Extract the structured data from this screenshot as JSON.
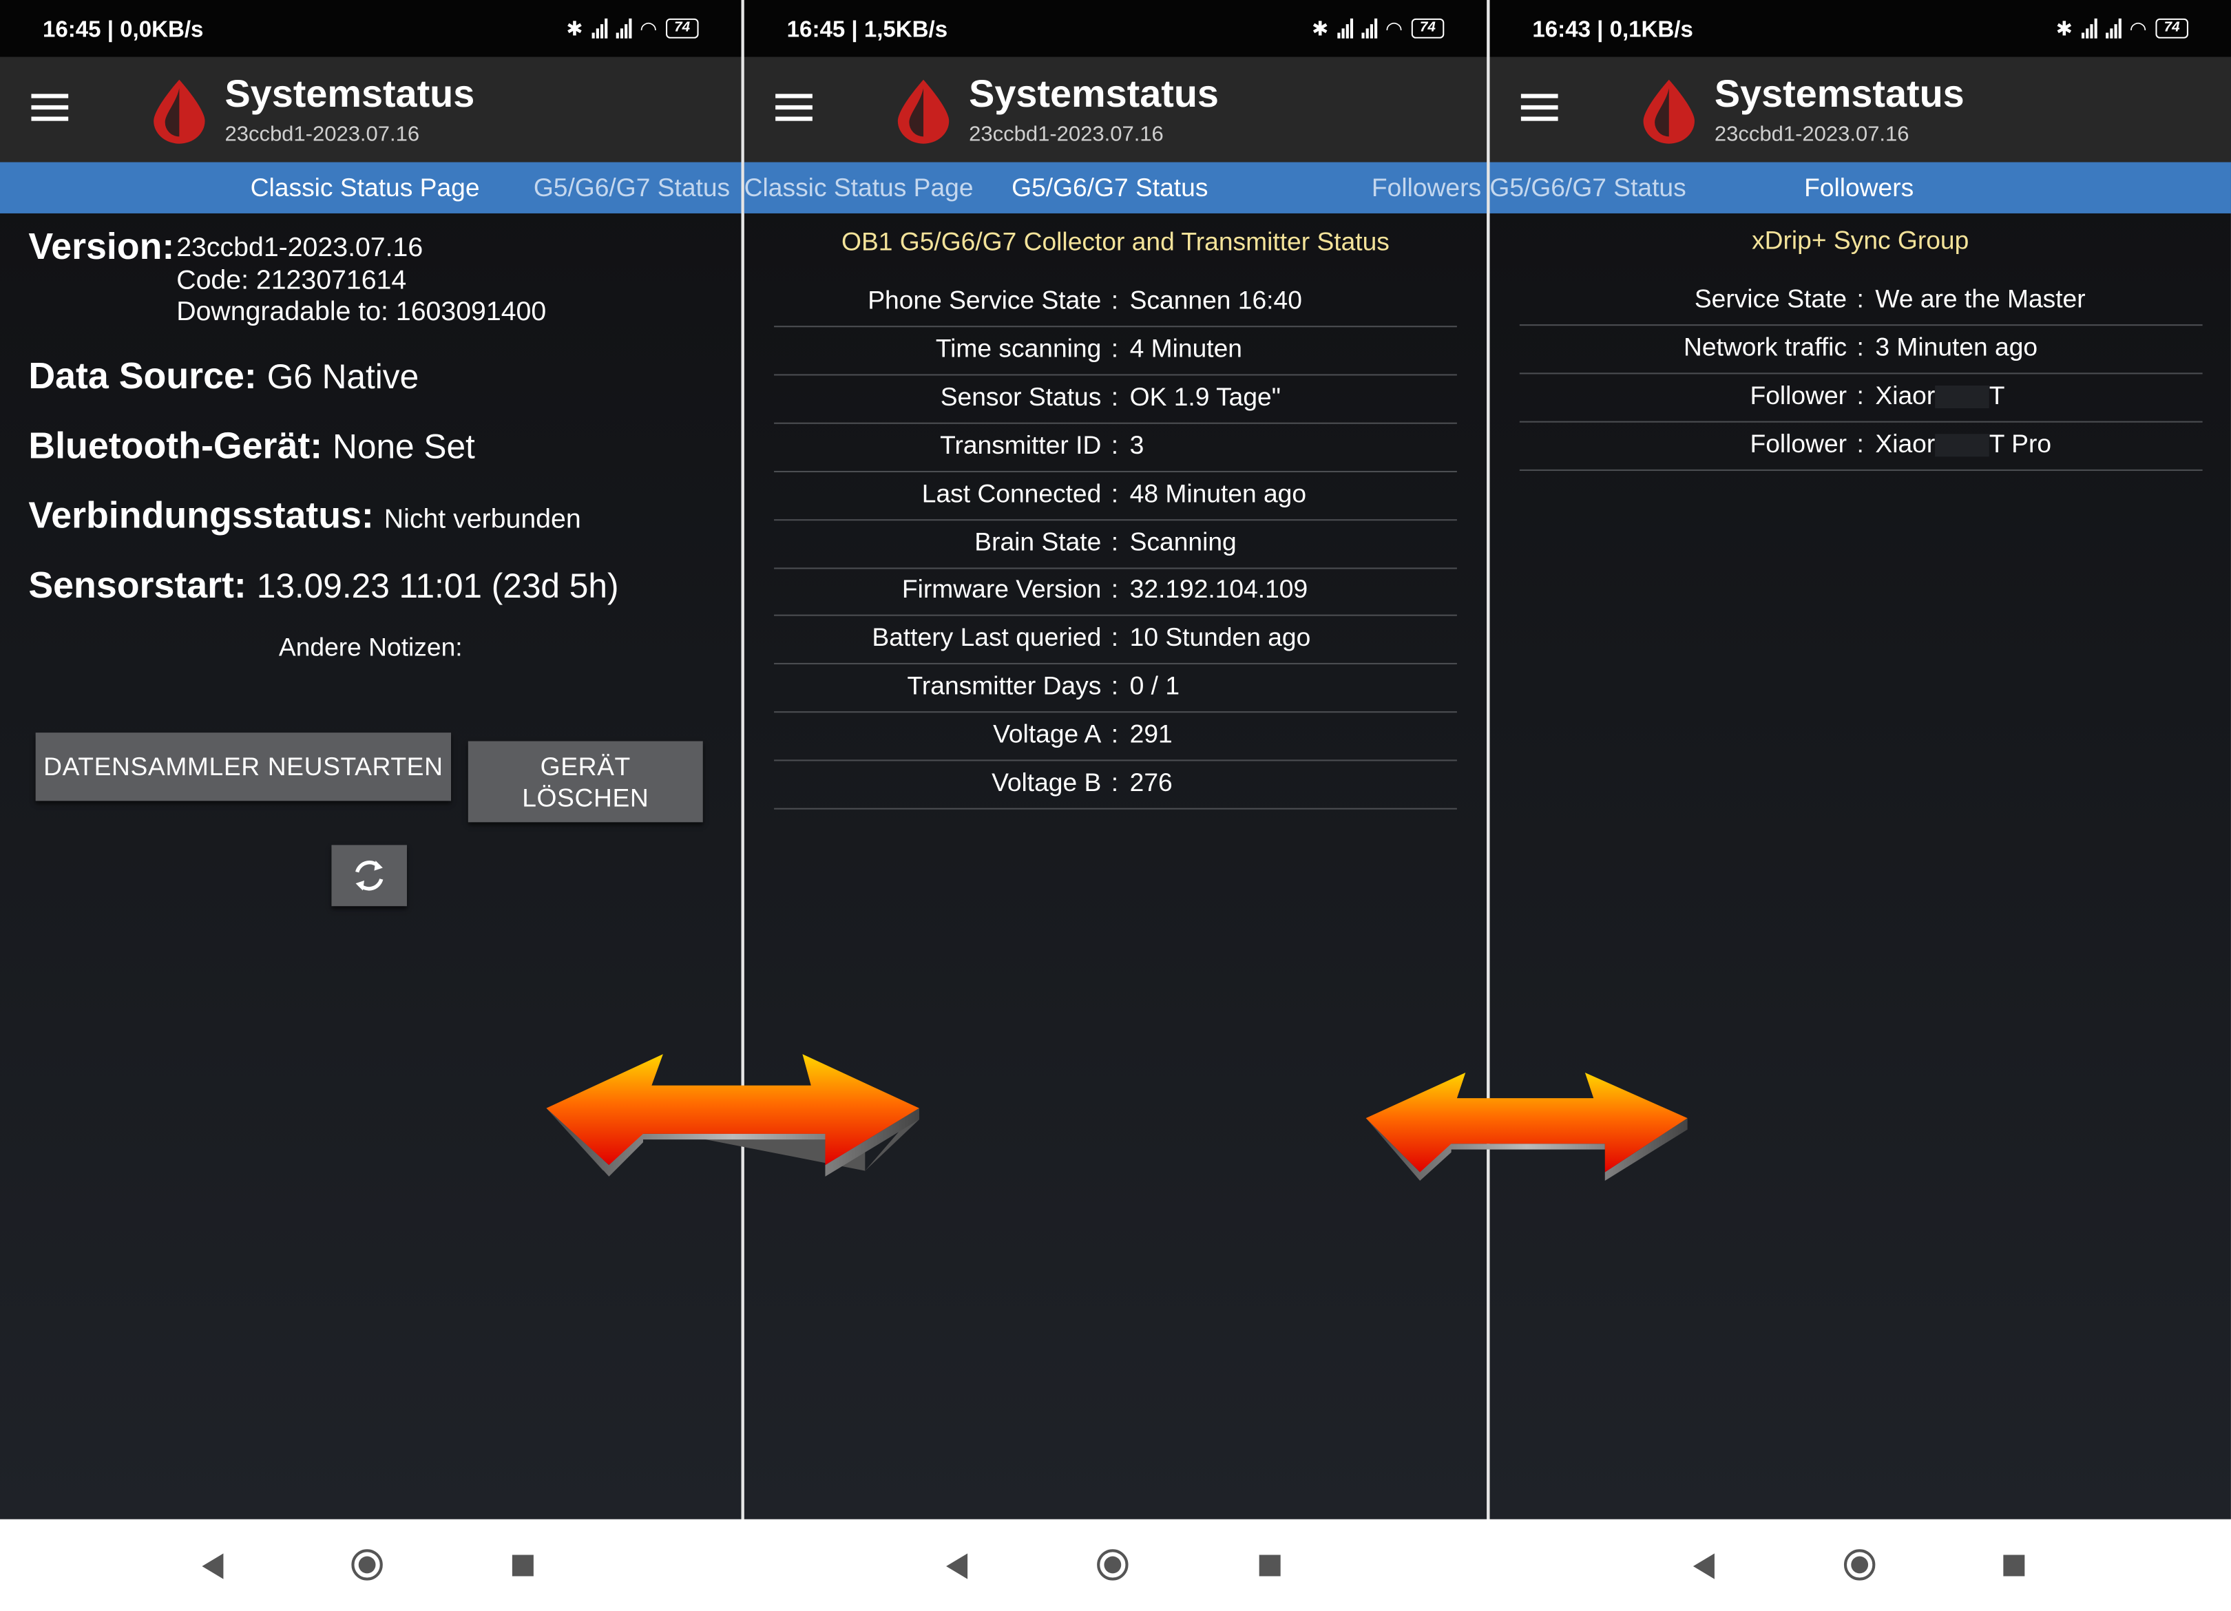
{
  "panels": [
    {
      "status_bar": {
        "time": "16:45 | 0,0KB/s",
        "battery": "74"
      },
      "app": {
        "title": "Systemstatus",
        "subtitle": "23ccbd1-2023.07.16"
      },
      "tabs": [
        "Classic Status Page",
        "G5/G6/G7 Status"
      ],
      "classic": {
        "version_label": "Version:",
        "version_value": "23ccbd1-2023.07.16",
        "code": "Code: 2123071614",
        "downgradable": "Downgradable to: 1603091400",
        "data_source_label": "Data Source:",
        "data_source_value": "G6 Native",
        "bluetooth_label": "Bluetooth-Gerät:",
        "bluetooth_value": "None Set",
        "connection_label": "Verbindungsstatus:",
        "connection_value": "Nicht verbunden",
        "sensorstart_label": "Sensorstart:",
        "sensorstart_value": "13.09.23 11:01 (23d 5h)",
        "notes_label": "Andere Notizen:",
        "restart_button": "DATENSAMMLER NEUSTARTEN",
        "delete_button_line1": "GERÄT",
        "delete_button_line2": "LÖSCHEN"
      }
    },
    {
      "status_bar": {
        "time": "16:45 | 1,5KB/s",
        "battery": "74"
      },
      "app": {
        "title": "Systemstatus",
        "subtitle": "23ccbd1-2023.07.16"
      },
      "tabs": [
        "Classic Status Page",
        "G5/G6/G7 Status",
        "Followers"
      ],
      "table_title": "OB1 G5/G6/G7 Collector and Transmitter Status",
      "rows": [
        {
          "key": "Phone Service State",
          "value": "Scannen 16:40"
        },
        {
          "key": "Time scanning",
          "value": "4 Minuten"
        },
        {
          "key": "Sensor Status",
          "value": "OK 1.9 Tage\""
        },
        {
          "key": "Transmitter ID",
          "value": "3"
        },
        {
          "key": "Last Connected",
          "value": "48 Minuten ago"
        },
        {
          "key": "Brain State",
          "value": "Scanning"
        },
        {
          "key": "Firmware Version",
          "value": "32.192.104.109"
        },
        {
          "key": "Battery Last queried",
          "value": "10 Stunden ago"
        },
        {
          "key": "Transmitter Days",
          "value": "0 / 1"
        },
        {
          "key": "Voltage A",
          "value": "291"
        },
        {
          "key": "Voltage B",
          "value": "276"
        }
      ]
    },
    {
      "status_bar": {
        "time": "16:43 | 0,1KB/s",
        "battery": "74"
      },
      "app": {
        "title": "Systemstatus",
        "subtitle": "23ccbd1-2023.07.16"
      },
      "tabs": [
        "G5/G6/G7 Status",
        "Followers"
      ],
      "table_title": "xDrip+ Sync Group",
      "rows": [
        {
          "key": "Service State",
          "value": "We are the Master"
        },
        {
          "key": "Network traffic",
          "value": "3 Minuten ago"
        },
        {
          "key": "Follower",
          "value": "Xiaor",
          "value_suffix": "T"
        },
        {
          "key": "Follower",
          "value": "Xiaor",
          "value_suffix": "T Pro"
        }
      ]
    }
  ],
  "separator": ":",
  "colors": {
    "tab_bar": "#3c7ac0",
    "app_bar": "#282828",
    "table_title": "#f4e39a",
    "drop_red": "#c8201e"
  }
}
